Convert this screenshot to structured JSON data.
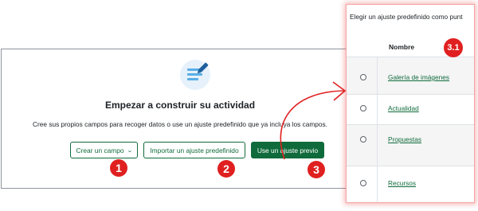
{
  "card": {
    "title": "Empezar a construir su actividad",
    "description": "Cree sus propios campos para recoger datos o use un ajuste predefinido que ya incluya los campos.",
    "icon": "form-edit-icon",
    "buttons": {
      "create_field": "Crear un campo",
      "import_preset": "Importar un ajuste predefinido",
      "use_preset": "Use un ajuste previo"
    }
  },
  "panel": {
    "header": "Elegir un ajuste predefinido como punt",
    "column_header": "Nombre",
    "rows": [
      "Galería de imágenes",
      "Actualidad",
      "Propuestas",
      "Recursos"
    ]
  },
  "annotations": {
    "badges": [
      "1",
      "2",
      "3",
      "3.1"
    ],
    "color": "#e02020"
  },
  "colors": {
    "accent": "#0f6b3b",
    "icon_blue": "#6ab7e8"
  }
}
